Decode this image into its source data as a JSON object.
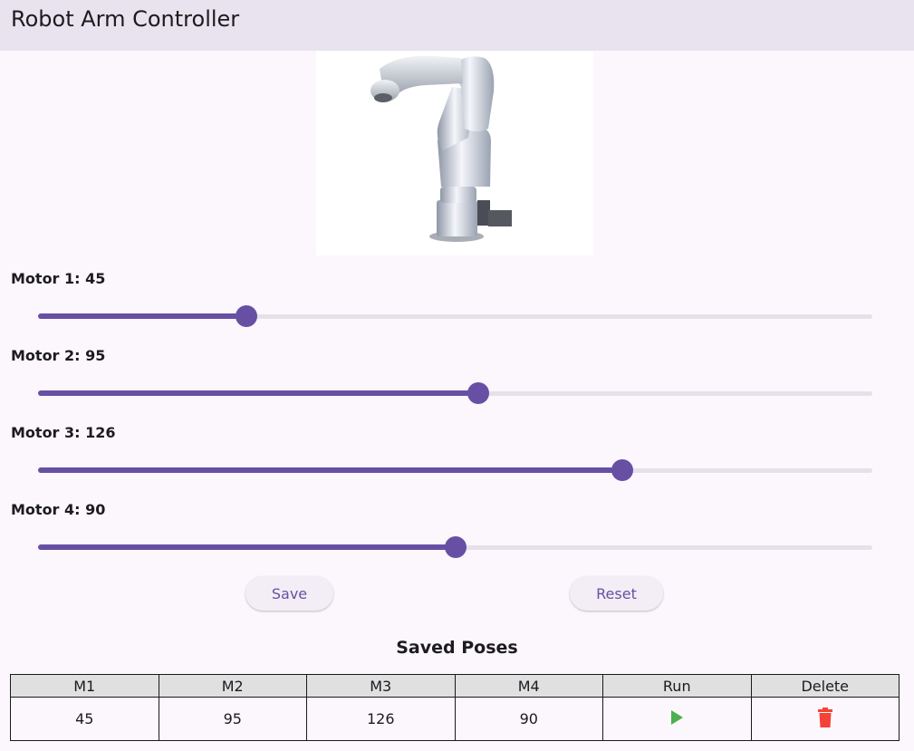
{
  "app": {
    "title": "Robot Arm Controller"
  },
  "colors": {
    "accent": "#6750a4",
    "track": "#e6e0e9",
    "appbar": "#e8e3ee",
    "run": "#4caf50",
    "delete": "#f44336"
  },
  "motors": [
    {
      "label": "Motor 1: 45",
      "value": 45,
      "min": 0,
      "max": 180
    },
    {
      "label": "Motor 2: 95",
      "value": 95,
      "min": 0,
      "max": 180
    },
    {
      "label": "Motor 3: 126",
      "value": 126,
      "min": 0,
      "max": 180
    },
    {
      "label": "Motor 4: 90",
      "value": 90,
      "min": 0,
      "max": 180
    }
  ],
  "buttons": {
    "save": "Save",
    "reset": "Reset"
  },
  "saved_poses": {
    "title": "Saved Poses",
    "columns": [
      "M1",
      "M2",
      "M3",
      "M4",
      "Run",
      "Delete"
    ],
    "rows": [
      {
        "m1": "45",
        "m2": "95",
        "m3": "126",
        "m4": "90",
        "run_icon": "play-icon",
        "delete_icon": "trash-icon"
      }
    ]
  }
}
